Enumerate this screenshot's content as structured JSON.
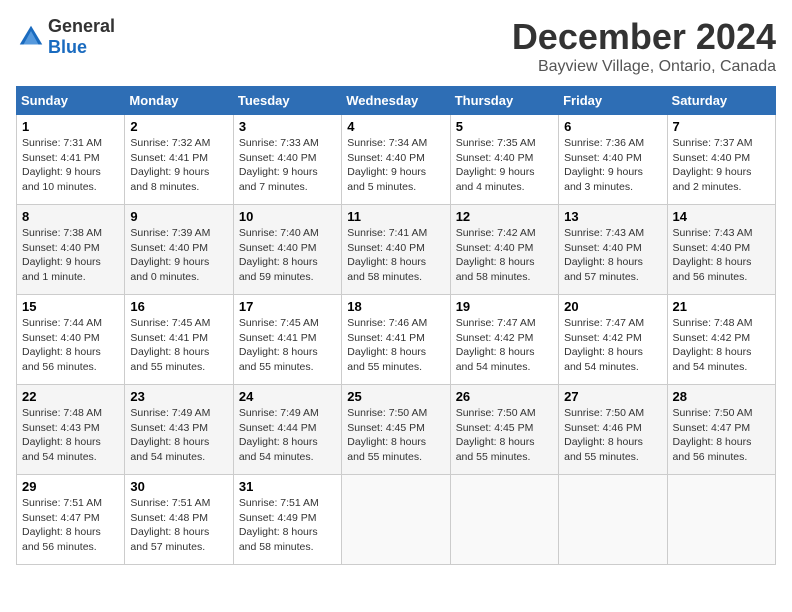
{
  "logo": {
    "general": "General",
    "blue": "Blue"
  },
  "title": {
    "month": "December 2024",
    "location": "Bayview Village, Ontario, Canada"
  },
  "days_of_week": [
    "Sunday",
    "Monday",
    "Tuesday",
    "Wednesday",
    "Thursday",
    "Friday",
    "Saturday"
  ],
  "weeks": [
    [
      {
        "day": "1",
        "sunrise": "7:31 AM",
        "sunset": "4:41 PM",
        "daylight": "9 hours and 10 minutes."
      },
      {
        "day": "2",
        "sunrise": "7:32 AM",
        "sunset": "4:41 PM",
        "daylight": "9 hours and 8 minutes."
      },
      {
        "day": "3",
        "sunrise": "7:33 AM",
        "sunset": "4:40 PM",
        "daylight": "9 hours and 7 minutes."
      },
      {
        "day": "4",
        "sunrise": "7:34 AM",
        "sunset": "4:40 PM",
        "daylight": "9 hours and 5 minutes."
      },
      {
        "day": "5",
        "sunrise": "7:35 AM",
        "sunset": "4:40 PM",
        "daylight": "9 hours and 4 minutes."
      },
      {
        "day": "6",
        "sunrise": "7:36 AM",
        "sunset": "4:40 PM",
        "daylight": "9 hours and 3 minutes."
      },
      {
        "day": "7",
        "sunrise": "7:37 AM",
        "sunset": "4:40 PM",
        "daylight": "9 hours and 2 minutes."
      }
    ],
    [
      {
        "day": "8",
        "sunrise": "7:38 AM",
        "sunset": "4:40 PM",
        "daylight": "9 hours and 1 minute."
      },
      {
        "day": "9",
        "sunrise": "7:39 AM",
        "sunset": "4:40 PM",
        "daylight": "9 hours and 0 minutes."
      },
      {
        "day": "10",
        "sunrise": "7:40 AM",
        "sunset": "4:40 PM",
        "daylight": "8 hours and 59 minutes."
      },
      {
        "day": "11",
        "sunrise": "7:41 AM",
        "sunset": "4:40 PM",
        "daylight": "8 hours and 58 minutes."
      },
      {
        "day": "12",
        "sunrise": "7:42 AM",
        "sunset": "4:40 PM",
        "daylight": "8 hours and 58 minutes."
      },
      {
        "day": "13",
        "sunrise": "7:43 AM",
        "sunset": "4:40 PM",
        "daylight": "8 hours and 57 minutes."
      },
      {
        "day": "14",
        "sunrise": "7:43 AM",
        "sunset": "4:40 PM",
        "daylight": "8 hours and 56 minutes."
      }
    ],
    [
      {
        "day": "15",
        "sunrise": "7:44 AM",
        "sunset": "4:40 PM",
        "daylight": "8 hours and 56 minutes."
      },
      {
        "day": "16",
        "sunrise": "7:45 AM",
        "sunset": "4:41 PM",
        "daylight": "8 hours and 55 minutes."
      },
      {
        "day": "17",
        "sunrise": "7:45 AM",
        "sunset": "4:41 PM",
        "daylight": "8 hours and 55 minutes."
      },
      {
        "day": "18",
        "sunrise": "7:46 AM",
        "sunset": "4:41 PM",
        "daylight": "8 hours and 55 minutes."
      },
      {
        "day": "19",
        "sunrise": "7:47 AM",
        "sunset": "4:42 PM",
        "daylight": "8 hours and 54 minutes."
      },
      {
        "day": "20",
        "sunrise": "7:47 AM",
        "sunset": "4:42 PM",
        "daylight": "8 hours and 54 minutes."
      },
      {
        "day": "21",
        "sunrise": "7:48 AM",
        "sunset": "4:42 PM",
        "daylight": "8 hours and 54 minutes."
      }
    ],
    [
      {
        "day": "22",
        "sunrise": "7:48 AM",
        "sunset": "4:43 PM",
        "daylight": "8 hours and 54 minutes."
      },
      {
        "day": "23",
        "sunrise": "7:49 AM",
        "sunset": "4:43 PM",
        "daylight": "8 hours and 54 minutes."
      },
      {
        "day": "24",
        "sunrise": "7:49 AM",
        "sunset": "4:44 PM",
        "daylight": "8 hours and 54 minutes."
      },
      {
        "day": "25",
        "sunrise": "7:50 AM",
        "sunset": "4:45 PM",
        "daylight": "8 hours and 55 minutes."
      },
      {
        "day": "26",
        "sunrise": "7:50 AM",
        "sunset": "4:45 PM",
        "daylight": "8 hours and 55 minutes."
      },
      {
        "day": "27",
        "sunrise": "7:50 AM",
        "sunset": "4:46 PM",
        "daylight": "8 hours and 55 minutes."
      },
      {
        "day": "28",
        "sunrise": "7:50 AM",
        "sunset": "4:47 PM",
        "daylight": "8 hours and 56 minutes."
      }
    ],
    [
      {
        "day": "29",
        "sunrise": "7:51 AM",
        "sunset": "4:47 PM",
        "daylight": "8 hours and 56 minutes."
      },
      {
        "day": "30",
        "sunrise": "7:51 AM",
        "sunset": "4:48 PM",
        "daylight": "8 hours and 57 minutes."
      },
      {
        "day": "31",
        "sunrise": "7:51 AM",
        "sunset": "4:49 PM",
        "daylight": "8 hours and 58 minutes."
      },
      null,
      null,
      null,
      null
    ]
  ]
}
